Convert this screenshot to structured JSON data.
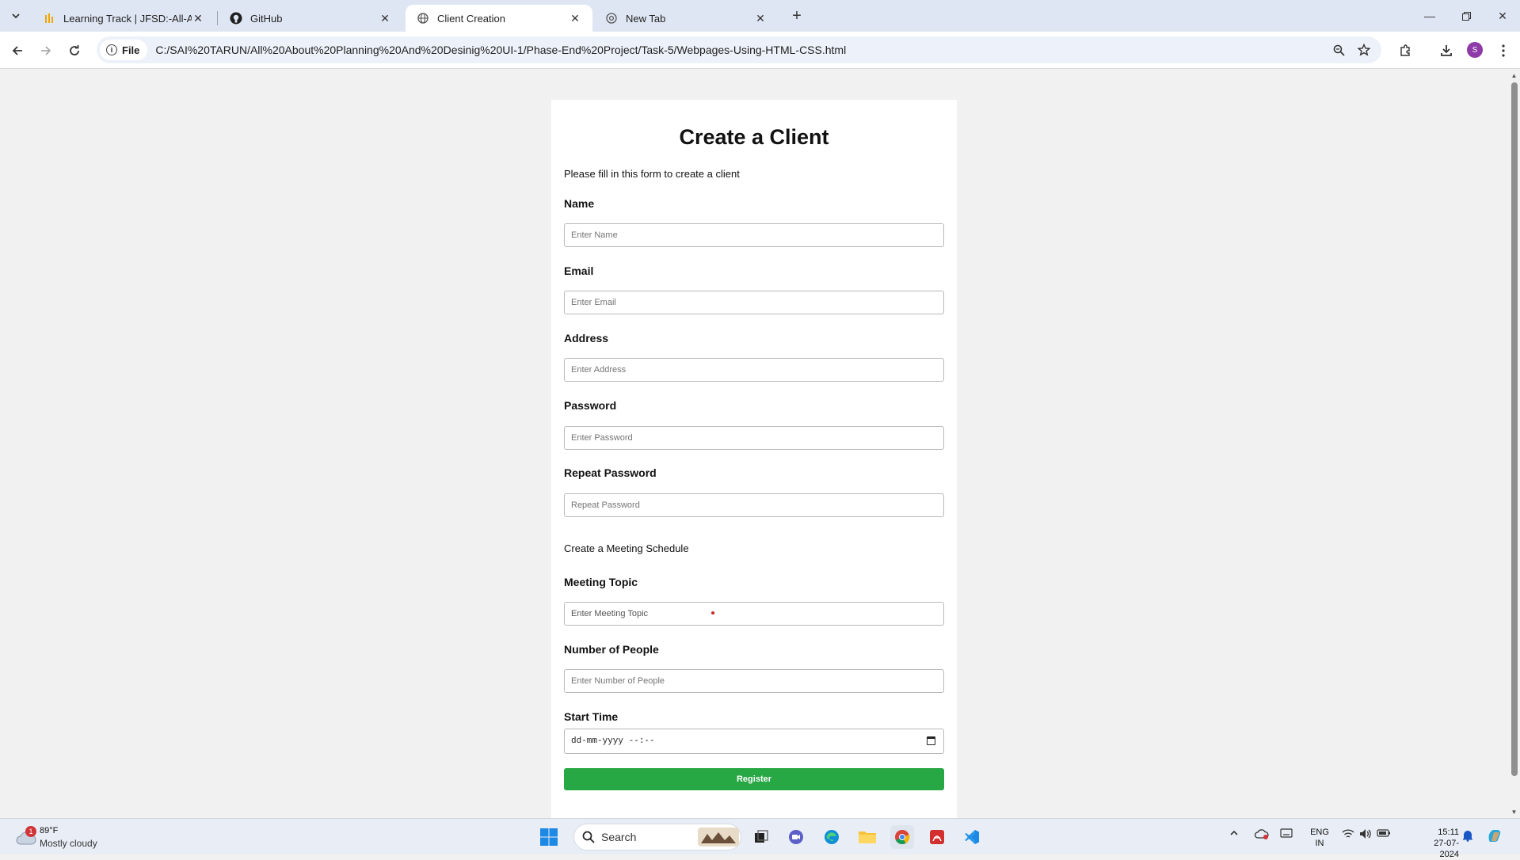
{
  "browser": {
    "tabs": [
      {
        "title": "Learning Track | JFSD:-All-About",
        "active": false
      },
      {
        "title": "GitHub",
        "active": false
      },
      {
        "title": "Client Creation",
        "active": true
      },
      {
        "title": "New Tab",
        "active": false
      }
    ],
    "site_chip": "File",
    "url": "C:/SAI%20TARUN/All%20About%20Planning%20And%20Desinig%20UI-1/Phase-End%20Project/Task-5/Webpages-Using-HTML-CSS.html",
    "profile_initial": "S"
  },
  "form": {
    "title": "Create a Client",
    "intro": "Please fill in this form to create a client",
    "name": {
      "label": "Name",
      "placeholder": "Enter Name"
    },
    "email": {
      "label": "Email",
      "placeholder": "Enter Email"
    },
    "address": {
      "label": "Address",
      "placeholder": "Enter Address"
    },
    "password": {
      "label": "Password",
      "placeholder": "Enter Password"
    },
    "repeat_password": {
      "label": "Repeat Password",
      "placeholder": "Repeat Password"
    },
    "meeting_section": "Create a Meeting Schedule",
    "meeting_topic": {
      "label": "Meeting Topic",
      "placeholder": "Enter Meeting Topic"
    },
    "num_people": {
      "label": "Number of People",
      "placeholder": "Enter Number of People"
    },
    "start_time": {
      "label": "Start Time",
      "value": "dd-mm-yyyy --:--"
    },
    "register_label": "Register"
  },
  "taskbar": {
    "weather_temp": "89°F",
    "weather_condition": "Mostly cloudy",
    "weather_badge": "1",
    "search_label": "Search",
    "lang_line1": "ENG",
    "lang_line2": "IN",
    "time": "15:11",
    "date": "27-07-2024"
  },
  "colors": {
    "register_button": "#28a745",
    "tabbar": "#dfe6f3",
    "page_background": "#f1f1f1"
  }
}
